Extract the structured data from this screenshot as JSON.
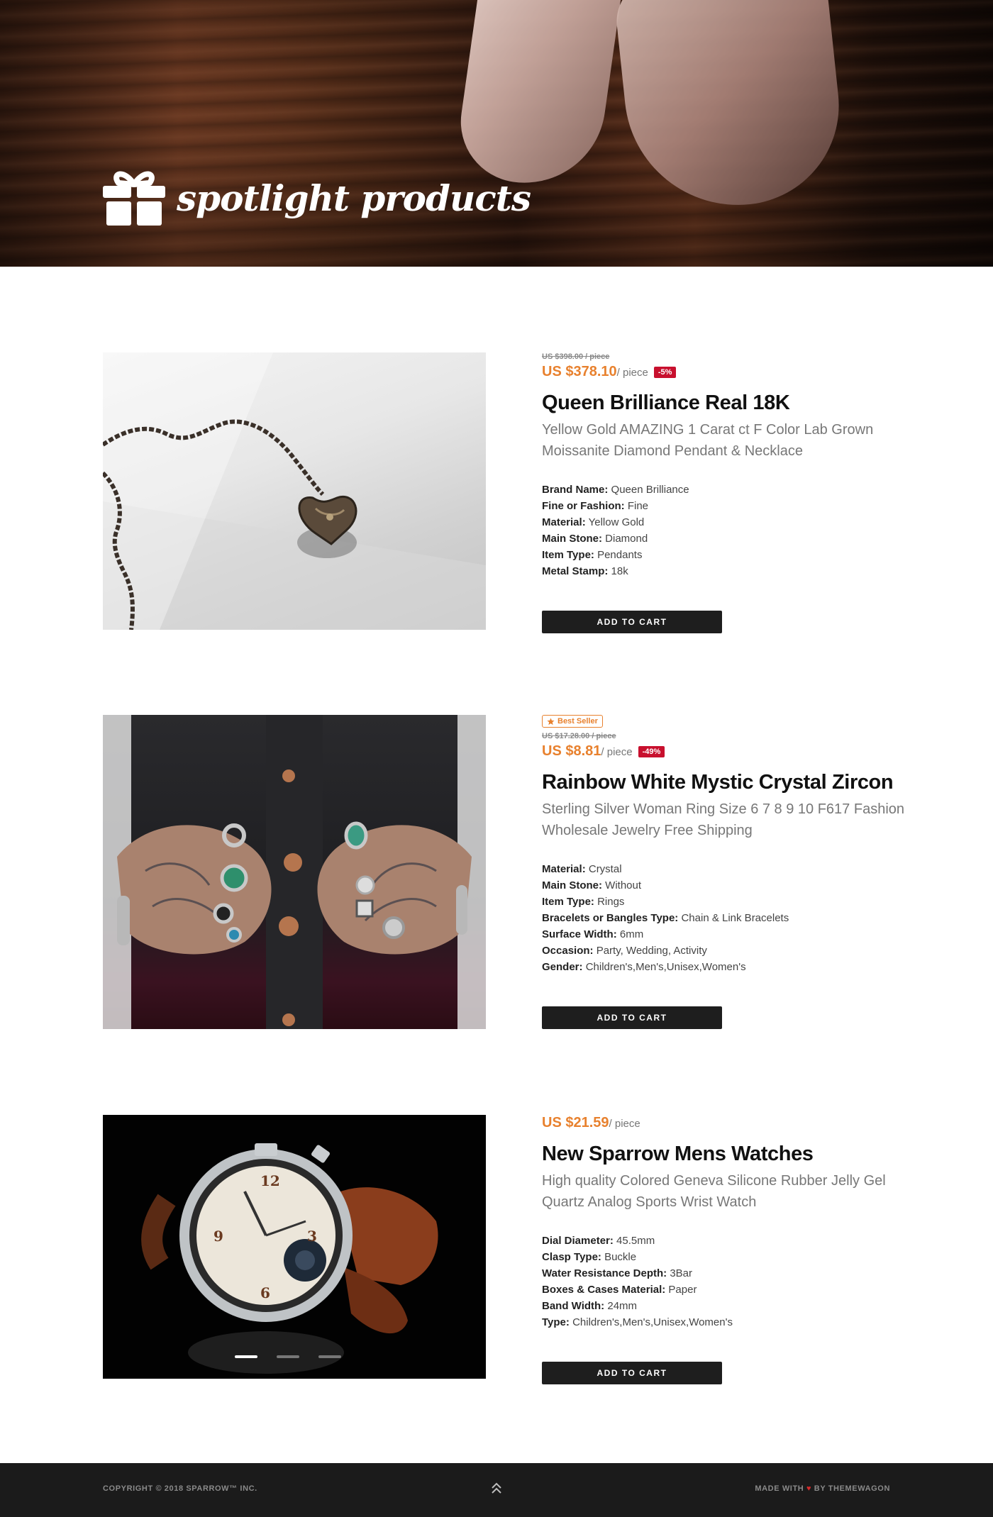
{
  "hero": {
    "title": "spotlight products",
    "icon": "gift-icon"
  },
  "products": [
    {
      "old_price": "US $398.00 / piece",
      "price": "US $378.10",
      "unit": "/ piece",
      "discount": "-5%",
      "title": "Queen Brilliance Real 18K",
      "subtitle": "Yellow Gold AMAZING 1 Carat ct F Color Lab Grown Moissanite Diamond Pendant & Necklace",
      "specs": [
        {
          "label": "Brand Name:",
          "value": "Queen Brilliance"
        },
        {
          "label": "Fine or Fashion:",
          "value": "Fine"
        },
        {
          "label": "Material:",
          "value": "Yellow Gold"
        },
        {
          "label": "Main Stone:",
          "value": "Diamond"
        },
        {
          "label": "Item Type:",
          "value": "Pendants"
        },
        {
          "label": "Metal Stamp:",
          "value": "18k"
        }
      ],
      "cart_label": "ADD TO CART"
    },
    {
      "badge": "Best Seller",
      "old_price": "US $17.28.00 / piece",
      "price": "US $8.81",
      "unit": "/ piece",
      "discount": "-49%",
      "title": "Rainbow White Mystic Crystal Zircon",
      "subtitle": "Sterling Silver Woman Ring Size 6 7 8 9 10 F617 Fashion Wholesale Jewelry Free Shipping",
      "specs": [
        {
          "label": "Material:",
          "value": "Crystal"
        },
        {
          "label": "Main Stone:",
          "value": "Without"
        },
        {
          "label": "Item Type:",
          "value": "Rings"
        },
        {
          "label": "Bracelets or Bangles Type:",
          "value": "Chain & Link Bracelets"
        },
        {
          "label": "Surface Width:",
          "value": "6mm"
        },
        {
          "label": "Occasion:",
          "value": "Party, Wedding, Activity"
        },
        {
          "label": "Gender:",
          "value": "Children's,Men's,Unisex,Women's"
        }
      ],
      "cart_label": "ADD TO CART"
    },
    {
      "price": "US $21.59",
      "unit": "/ piece",
      "title": "New Sparrow Mens Watches",
      "subtitle": "High quality Colored Geneva Silicone Rubber Jelly Gel Quartz Analog Sports Wrist Watch",
      "specs": [
        {
          "label": "Dial Diameter:",
          "value": "45.5mm"
        },
        {
          "label": "Clasp Type:",
          "value": "Buckle"
        },
        {
          "label": "Water Resistance Depth:",
          "value": "3Bar"
        },
        {
          "label": "Boxes & Cases Material:",
          "value": "Paper"
        },
        {
          "label": "Band Width:",
          "value": "24mm"
        },
        {
          "label": "Type:",
          "value": "Children's,Men's,Unisex,Women's"
        }
      ],
      "cart_label": "ADD TO CART"
    }
  ],
  "footer": {
    "copyright": "COPYRIGHT © 2018 SPARROW™ INC.",
    "made_with": "MADE WITH",
    "by": "BY THEMEWAGON",
    "heart_icon": "heart-icon",
    "top_icon": "double-chevron-up-icon"
  },
  "colors": {
    "accent": "#e8812e",
    "discount": "#c8102e",
    "button": "#1e1e1e",
    "footer": "#1b1b1b"
  }
}
